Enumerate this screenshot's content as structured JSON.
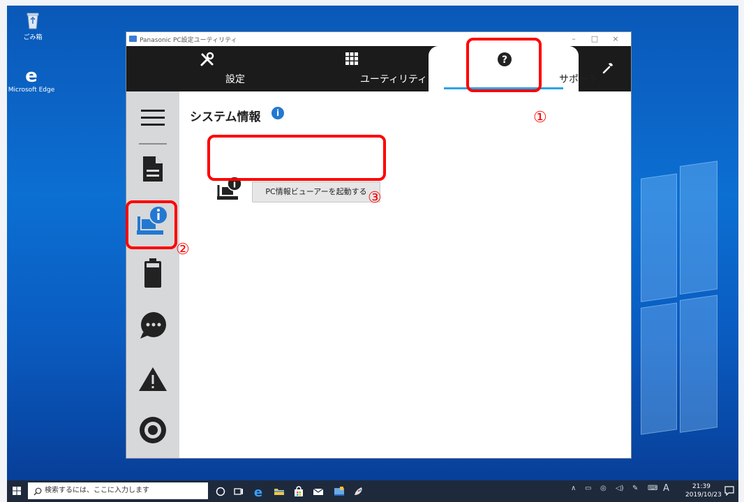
{
  "desktop": {
    "icons": [
      {
        "label": "ごみ箱",
        "icon": "recycle-bin-icon"
      },
      {
        "label": "Microsoft Edge",
        "icon": "edge-icon"
      }
    ]
  },
  "window": {
    "title": "Panasonic PC設定ユーティリティ",
    "controls": {
      "minimize": "–",
      "maximize": "□",
      "close": "×"
    },
    "tabs": [
      {
        "label": "設定",
        "icon": "tools-icon"
      },
      {
        "label": "ユーティリティ",
        "icon": "grid-icon"
      },
      {
        "label": "サポート",
        "icon": "help-circle-icon",
        "active": true
      },
      {
        "label": "",
        "icon": "wrench-icon"
      }
    ],
    "sidebar": [
      {
        "icon": "menu-icon"
      },
      {
        "icon": "document-icon"
      },
      {
        "icon": "pc-info-icon",
        "selected": true
      },
      {
        "icon": "battery-icon"
      },
      {
        "icon": "chat-icon"
      },
      {
        "icon": "warning-icon"
      },
      {
        "icon": "target-icon"
      }
    ],
    "content": {
      "section_title": "システム情報",
      "info_badge": "i",
      "launch_button": "PC情報ビューアーを起動する"
    }
  },
  "annotations": {
    "one": "①",
    "two": "②",
    "three": "③",
    "color": "#ff0000"
  },
  "taskbar": {
    "search_placeholder": "検索するには、ここに入力します",
    "ime": "A",
    "time": "21:39",
    "date": "2019/10/23"
  },
  "colors": {
    "accent": "#2aa3e8",
    "tabbar": "#1b1b1b",
    "sidebar": "#d6d8da",
    "pc_icon_selected": "#2378d1"
  }
}
